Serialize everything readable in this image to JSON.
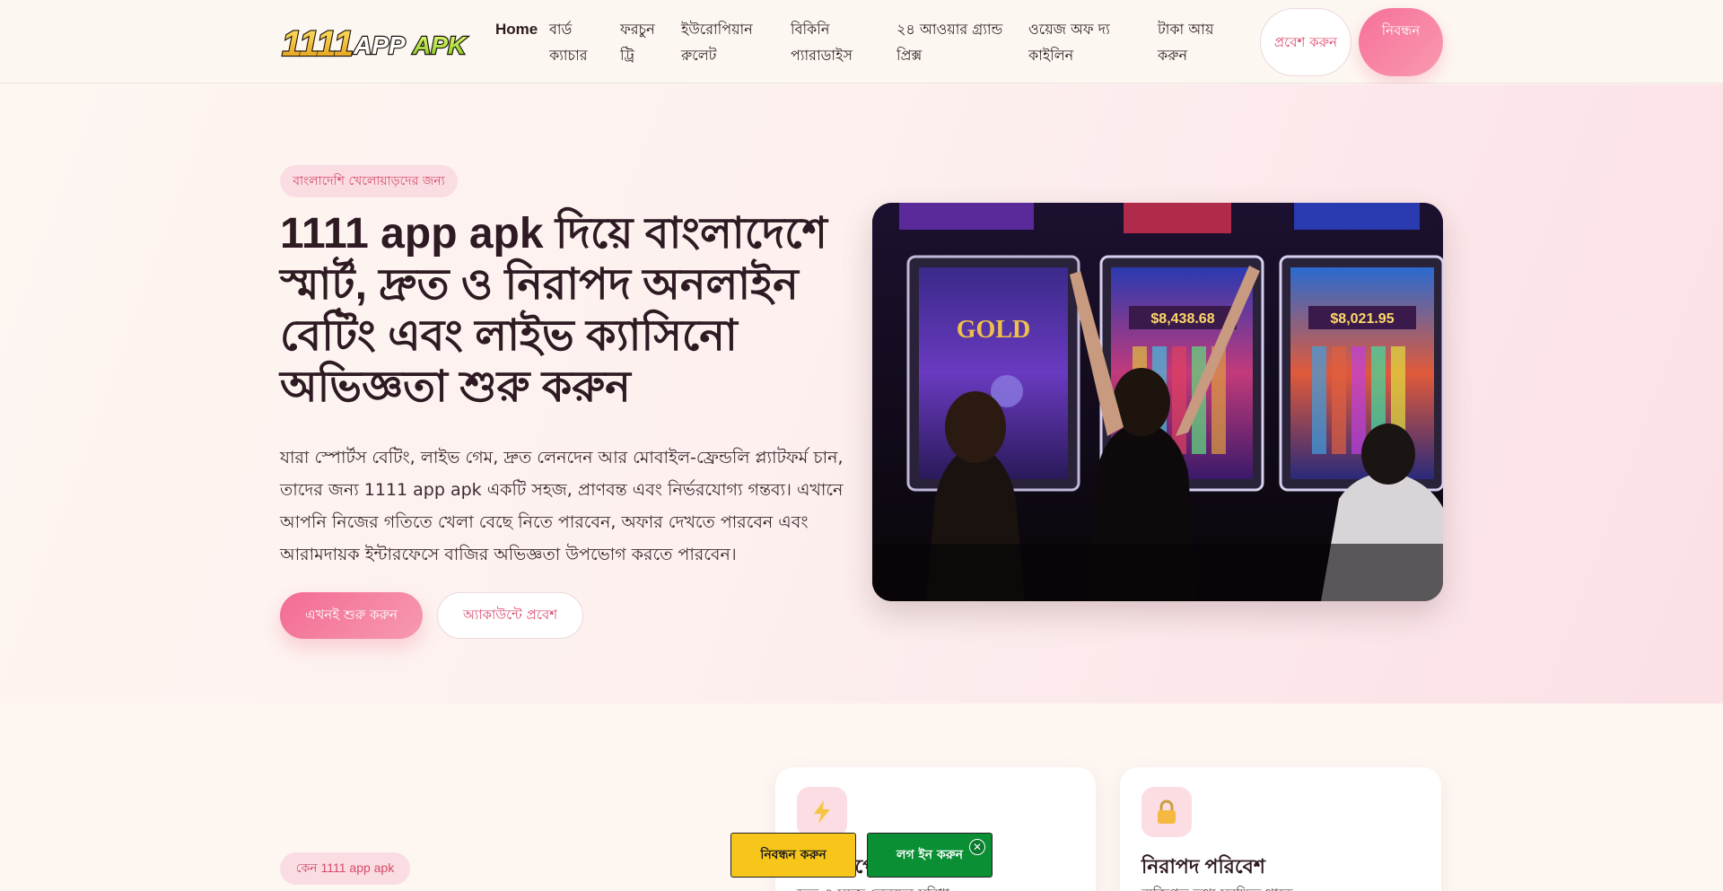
{
  "header": {
    "logo_text": "1111APPAPK",
    "nav": [
      {
        "label": "Home"
      },
      {
        "label": "বার্ড ক্যাচার"
      },
      {
        "label": "ফরচুন ট্রি"
      },
      {
        "label": "ইউরোপিয়ান রুলেট"
      },
      {
        "label": "বিকিনি প্যারাডাইস"
      },
      {
        "label": "২৪ আওয়ার গ্র্যান্ড প্রিক্স"
      },
      {
        "label": "ওয়েজ অফ দ্য কাইলিন"
      },
      {
        "label": "টাকা আয় করুন"
      }
    ],
    "login_label": "প্রবেশ করুন",
    "register_label": "নিবন্ধন"
  },
  "hero": {
    "tag": "বাংলাদেশি খেলোয়াড়দের জন্য",
    "title": "1111 app apk দিয়ে বাংলাদেশে স্মার্ট, দ্রুত ও নিরাপদ অনলাইন বেটিং এবং লাইভ ক্যাসিনো অভিজ্ঞতা শুরু করুন",
    "description": "যারা স্পোর্টস বেটিং, লাইভ গেম, দ্রুত লেনদেন আর মোবাইল-ফ্রেন্ডলি প্ল্যাটফর্ম চান, তাদের জন্য 1111 app apk একটি সহজ, প্রাণবন্ত এবং নির্ভরযোগ্য গন্তব্য। এখানে আপনি নিজের গতিতে খেলা বেছে নিতে পারবেন, অফার দেখতে পারবেন এবং আরামদায়ক ইন্টারফেসে বাজির অভিজ্ঞতা উপভোগ করতে পারবেন।",
    "start_label": "এখনই শুরু করুন",
    "account_label": "অ্যাকাউন্টে প্রবেশ",
    "image_texts": {
      "gold": "GOLD",
      "jackpot_1": "$8,438.68",
      "jackpot_2": "$8,021.95"
    }
  },
  "why": {
    "tag": "কেন 1111 app apk",
    "cards": [
      {
        "icon": "lightning-icon",
        "glyph": "⚡",
        "title": "দ্রুত ডিপোজিট",
        "text": "দ্রুত ও সহজ লেনদেন সুবিধা"
      },
      {
        "icon": "lock-icon",
        "glyph": "🔒",
        "title": "নিরাপদ পরিবেশ",
        "text": "ব্যক্তিগত তথ্য সুরক্ষিত থাকে"
      }
    ]
  },
  "floating_bar": {
    "register_label": "নিবন্ধন করুন",
    "login_label": "লগ ইন করুন",
    "close_glyph": "✕"
  },
  "colors": {
    "accent": "#f36b93",
    "accent_text": "#d94a6a",
    "float_register": "#f8c61a",
    "float_login": "#0a8f35"
  }
}
